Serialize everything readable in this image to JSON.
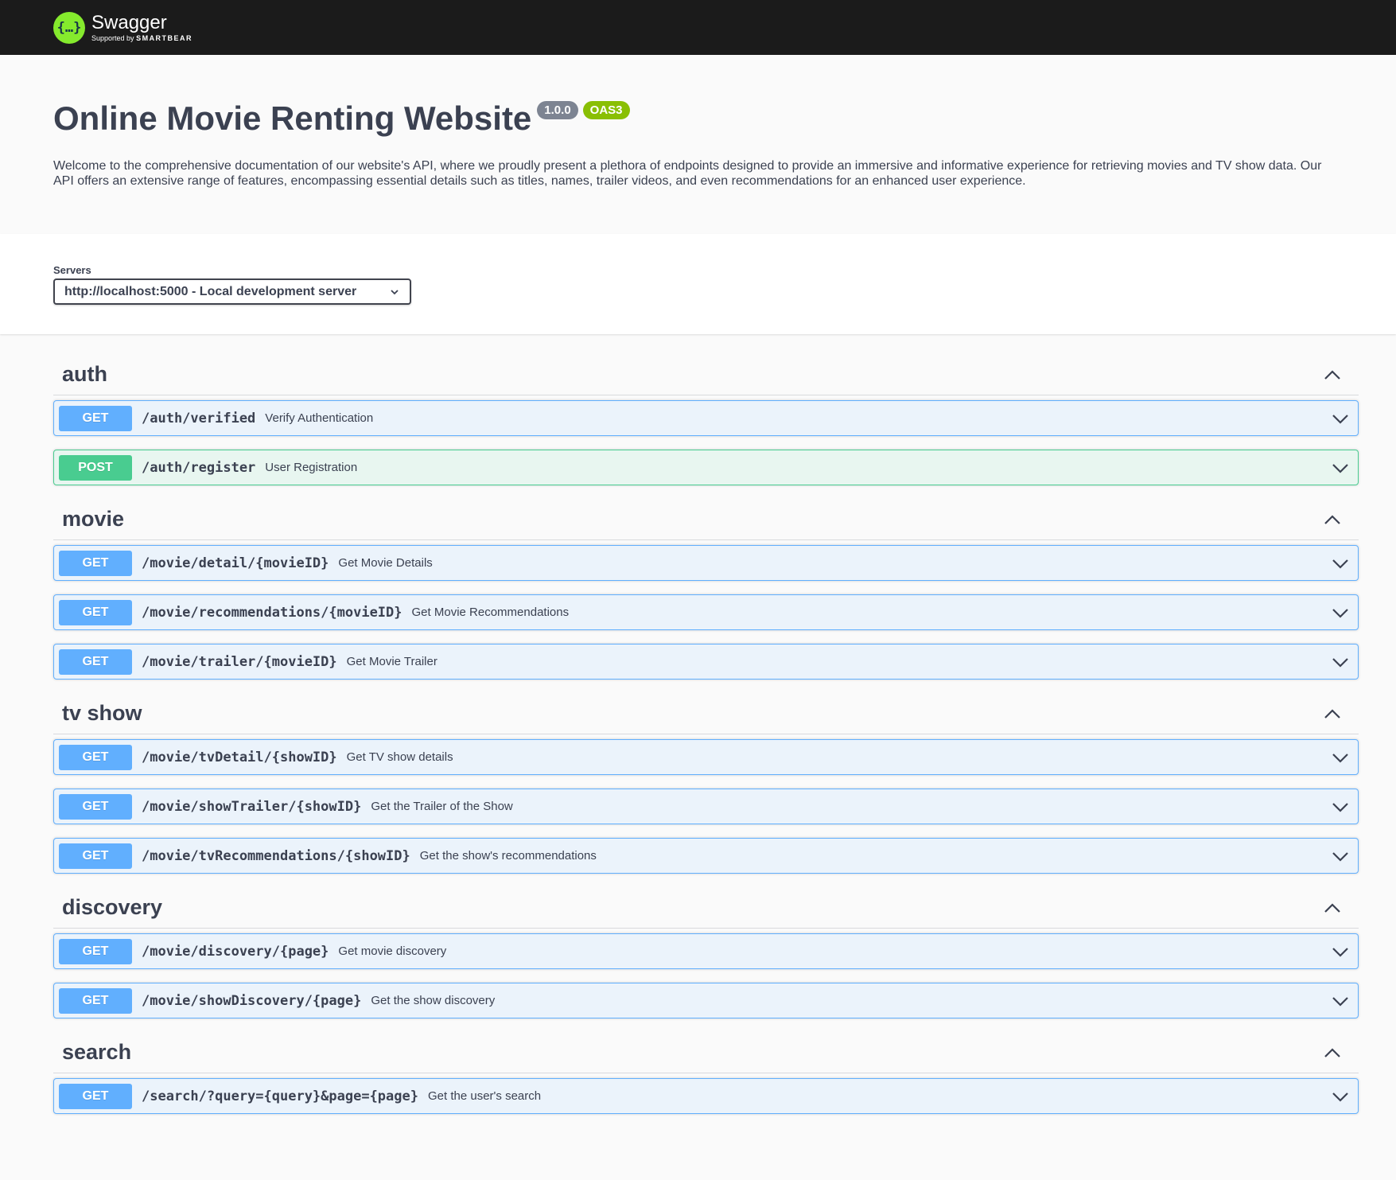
{
  "topbar": {
    "logo_glyph": "{…}",
    "brand_name": "Swagger",
    "brand_sub_prefix": "Supported by",
    "brand_sub_company": "SMARTBEAR"
  },
  "info": {
    "title": "Online Movie Renting Website",
    "version": "1.0.0",
    "oas": "OAS3",
    "description": "Welcome to the comprehensive documentation of our website's API, where we proudly present a plethora of endpoints designed to provide an immersive and informative experience for retrieving movies and TV show data. Our API offers an extensive range of features, encompassing essential details such as titles, names, trailer videos, and even recommendations for an enhanced user experience."
  },
  "servers": {
    "label": "Servers",
    "selected": "http://localhost:5000 - Local development server"
  },
  "colors": {
    "get": "#61affe",
    "post": "#49cc90",
    "topbar": "#1b1b1b",
    "logo": "#85ea2d",
    "version_badge": "#7d8492",
    "oas_badge": "#89bf04"
  },
  "tags": [
    {
      "name": "auth",
      "ops": [
        {
          "method": "GET",
          "path": "/auth/verified",
          "summary": "Verify Authentication"
        },
        {
          "method": "POST",
          "path": "/auth/register",
          "summary": "User Registration"
        }
      ]
    },
    {
      "name": "movie",
      "ops": [
        {
          "method": "GET",
          "path": "/movie/detail/{movieID}",
          "summary": "Get Movie Details"
        },
        {
          "method": "GET",
          "path": "/movie/recommendations/{movieID}",
          "summary": "Get Movie Recommendations"
        },
        {
          "method": "GET",
          "path": "/movie/trailer/{movieID}",
          "summary": "Get Movie Trailer"
        }
      ]
    },
    {
      "name": "tv show",
      "ops": [
        {
          "method": "GET",
          "path": "/movie/tvDetail/{showID}",
          "summary": "Get TV show details"
        },
        {
          "method": "GET",
          "path": "/movie/showTrailer/{showID}",
          "summary": "Get the Trailer of the Show"
        },
        {
          "method": "GET",
          "path": "/movie/tvRecommendations/{showID}",
          "summary": "Get the show's recommendations"
        }
      ]
    },
    {
      "name": "discovery",
      "ops": [
        {
          "method": "GET",
          "path": "/movie/discovery/{page}",
          "summary": "Get movie discovery"
        },
        {
          "method": "GET",
          "path": "/movie/showDiscovery/{page}",
          "summary": "Get the show discovery"
        }
      ]
    },
    {
      "name": "search",
      "ops": [
        {
          "method": "GET",
          "path": "/search/?query={query}&page={page}",
          "summary": "Get the user's search"
        }
      ]
    }
  ]
}
